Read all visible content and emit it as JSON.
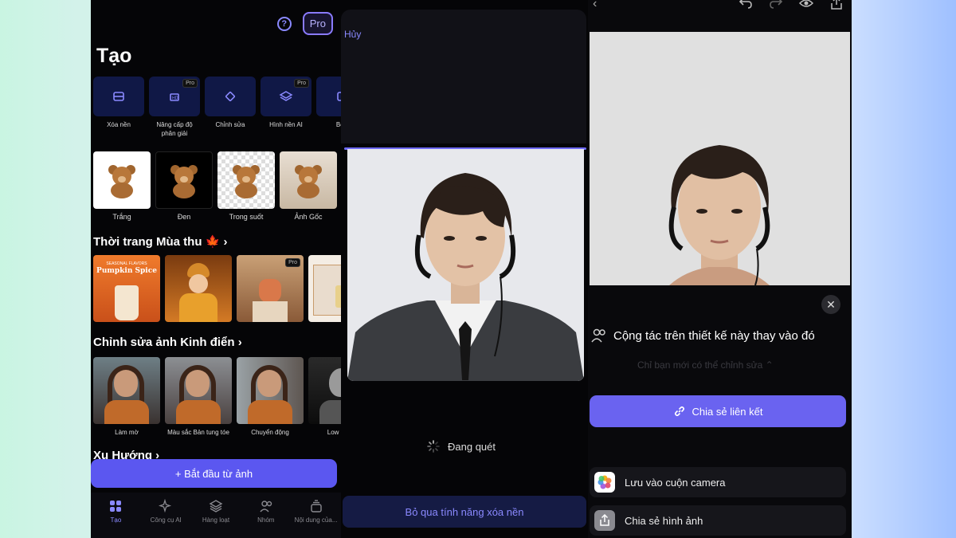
{
  "left": {
    "pro_label": "Pro",
    "title": "Tạo",
    "tools": [
      {
        "label": "Xóa nền",
        "badge": ""
      },
      {
        "label": "Nâng cấp độ phân giải",
        "badge": "Pro"
      },
      {
        "label": "Chỉnh sửa",
        "badge": ""
      },
      {
        "label": "Hình nền AI",
        "badge": "Pro"
      },
      {
        "label": "Bón",
        "badge": ""
      }
    ],
    "bears": [
      "Trắng",
      "Đen",
      "Trong suốt",
      "Ảnh Gốc"
    ],
    "section_autumn": "Thời trang Mùa thu 🍁 ›",
    "autumn_thumb_text": [
      "SEASONAL FLAVORS",
      "Pumpkin Spice"
    ],
    "autumn_badge": "Pro",
    "section_classic": "Chỉnh sửa ảnh Kinh điển ›",
    "classic": [
      "Làm mờ",
      "Màu sắc Bản tung tóe",
      "Chuyển động",
      "Low key (t"
    ],
    "section_trend": "Xu Hướng ›",
    "start_button": "+ Bắt đầu từ ảnh",
    "nav": [
      "Tạo",
      "Công cụ AI",
      "Hàng loạt",
      "Nhóm",
      "Nội dung của..."
    ]
  },
  "middle": {
    "cancel": "Hủy",
    "scanning": "Đang quét",
    "skip_button": "Bỏ qua tính năng xóa nền"
  },
  "right": {
    "collab_title": "Cộng tác trên thiết kế này thay vào đó",
    "only_you": "Chỉ bạn mới có thể chỉnh sửa ⌃",
    "share_link": "Chia sẻ liên kết",
    "save_camera": "Lưu vào cuộn camera",
    "share_image": "Chia sẻ hình ảnh"
  },
  "colors": {
    "accent": "#5b57f0",
    "accent_light": "#8a89ff",
    "dark": "#050507"
  }
}
